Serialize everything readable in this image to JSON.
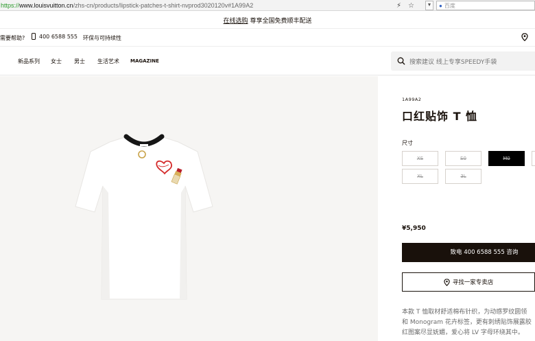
{
  "browser": {
    "url_scheme": "https://",
    "url_domain": "www.louisvuitton.cn",
    "url_path": "/zhs-cn/products/lipstick-patches-t-shirt-nvprod3020120v#1A99A2",
    "search_placeholder": "百度"
  },
  "promo": {
    "link_text": "在线选购",
    "text": "尊享全国免费顺丰配送"
  },
  "utility": {
    "help": "需要帮助?",
    "phone": "400 6588 555",
    "sustainability": "环保与可持续性"
  },
  "nav": {
    "items": [
      "新品系列",
      "女士",
      "男士",
      "生活艺术",
      "MAGAZINE"
    ],
    "search_placeholder": "搜索建议  线上专享SPEEDY手袋"
  },
  "product": {
    "sku": "1A99A2",
    "title": "口红贴饰 T 恤",
    "size_label": "尺寸",
    "sizes": [
      {
        "label": "XS",
        "available": false,
        "selected": false
      },
      {
        "label": "S0",
        "available": false,
        "selected": false
      },
      {
        "label": "M0",
        "available": false,
        "selected": true
      },
      {
        "label": "XL",
        "available": false,
        "selected": false
      },
      {
        "label": "3L",
        "available": false,
        "selected": false
      }
    ],
    "price": "¥5,950",
    "call_cta": "致电 400 6588 555 咨询",
    "store_cta": "寻找一家专卖店",
    "description": [
      "本款 T 恤取材舒适棉布针织，为动感罗纹圆领",
      "和 Monogram 花卉标签，更有刺绣贴饰展露胶",
      "红图案尽显妩媚，爱心将 LV 字母环绕其中。"
    ]
  },
  "colors": {
    "text": "#19110b",
    "panel_bg": "#f6f5f3",
    "cta_bg": "#19110b"
  }
}
